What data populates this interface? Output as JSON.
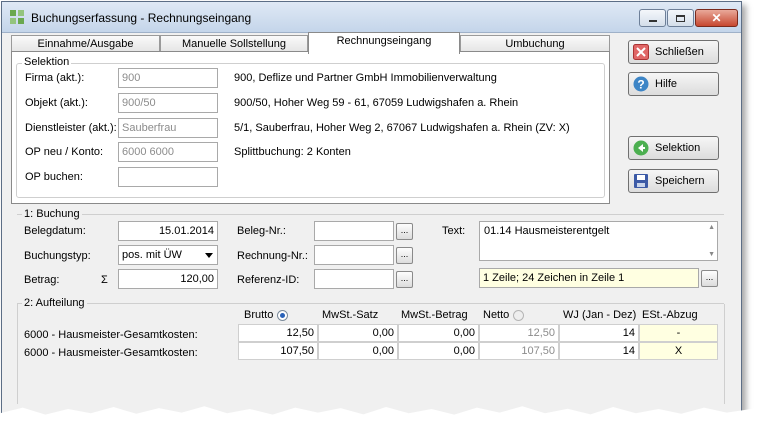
{
  "window": {
    "title": "Buchungserfassung - Rechnungseingang"
  },
  "tabs": [
    "Einnahme/Ausgabe",
    "Manuelle Sollstellung",
    "Rechnungseingang",
    "Umbuchung"
  ],
  "selektion": {
    "title": "Selektion",
    "rows": [
      {
        "label": "Firma (akt.):",
        "value": "900",
        "info": "900,  Deflize und Partner GmbH Immobilienverwaltung"
      },
      {
        "label": "Objekt (akt.):",
        "value": "900/50",
        "info": "900/50,  Hoher Weg 59 - 61, 67059 Ludwigshafen a. Rhein"
      },
      {
        "label": "Dienstleister (akt.):",
        "value": "Sauberfrau",
        "info": "5/1,  Sauberfrau,  Hoher Weg 2, 67067 Ludwigshafen a. Rhein  (ZV: X)"
      },
      {
        "label": "OP neu / Konto:",
        "value": "6000 6000",
        "info": "Splittbuchung:  2 Konten"
      },
      {
        "label": "OP buchen:",
        "value": "",
        "info": ""
      }
    ]
  },
  "buttons": {
    "close": "Schließen",
    "help": "Hilfe",
    "selection": "Selektion",
    "save": "Speichern"
  },
  "buchung": {
    "section_label": "1: Buchung",
    "belegdatum_label": "Belegdatum:",
    "belegdatum": "15.01.2014",
    "buchungstyp_label": "Buchungstyp:",
    "buchungstyp": "pos. mit ÜW",
    "betrag_label": "Betrag:",
    "sigma": "Σ",
    "betrag": "120,00",
    "belegnr_label": "Beleg-Nr.:",
    "rechnungnr_label": "Rechnung-Nr.:",
    "referenzid_label": "Referenz-ID:",
    "dots": "...",
    "text_label": "Text:",
    "text_value": "01.14 Hausmeisterentgelt",
    "text_status": "1 Zeile; 24 Zeichen in Zeile 1"
  },
  "aufteilung": {
    "section_label": "2: Aufteilung",
    "headers": [
      "Brutto",
      "MwSt.-Satz",
      "MwSt.-Betrag",
      "Netto",
      "WJ (Jan - Dez)",
      "ESt.-Abzug"
    ],
    "rows": [
      {
        "label": "6000 - Hausmeister-Gesamtkosten:",
        "brutto": "12,50",
        "mwst_satz": "0,00",
        "mwst_betrag": "0,00",
        "netto": "12,50",
        "wj": "14",
        "est": "-"
      },
      {
        "label": "6000 - Hausmeister-Gesamtkosten:",
        "brutto": "107,50",
        "mwst_satz": "0,00",
        "mwst_betrag": "0,00",
        "netto": "107,50",
        "wj": "14",
        "est": "X"
      }
    ]
  }
}
